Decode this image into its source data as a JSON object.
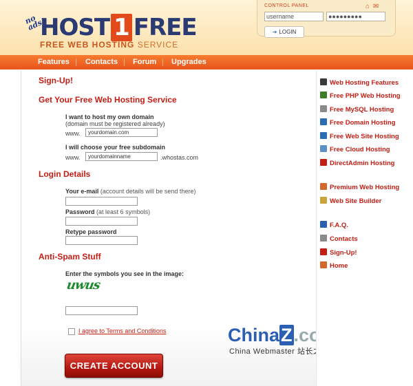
{
  "header": {
    "badge": "no ads!",
    "logo_host": "HOST",
    "logo_one": "1",
    "logo_free": "FREE",
    "tagline_main": "FREE WEB HOSTING",
    "tagline_service": "SERVICE"
  },
  "control_panel": {
    "title": "CONTROL PANEL",
    "username_value": "username",
    "password_value": "●●●●●●●●●",
    "login_label": "LOGIN",
    "home_icon": "home-icon",
    "mail_icon": "mail-icon"
  },
  "nav": {
    "items": [
      "Features",
      "Contacts",
      "Forum",
      "Upgrades"
    ]
  },
  "form": {
    "signup_title": "Sign-Up!",
    "section1_title": "Get Your Free Web Hosting Service",
    "own_domain_label": "I want to host my own domain",
    "own_domain_note": "(domain must be registered already)",
    "www_label_1": "www.",
    "own_domain_value": "yourdomain.com",
    "subdomain_label": "I will choose your free subdomain",
    "www_label_2": "www.",
    "subdomain_value": "yourdomainname",
    "subdomain_suffix": ".whostas.com",
    "section2_title": "Login Details",
    "email_label": "Your e-mail",
    "email_note": "(account details will be send there)",
    "password_label": "Password",
    "password_note": "(at least 6 symbols)",
    "retype_label": "Retype password",
    "section3_title": "Anti-Spam Stuff",
    "captcha_prompt": "Enter the symbols you see in the image:",
    "captcha_text": "uwus",
    "agree_label": "I agree to Terms and Conditions",
    "create_button": "CREATE ACCOUNT"
  },
  "watermark": {
    "brand_china": "China",
    "brand_z": "Z",
    "brand_com": ".com",
    "subtitle": "China Webmaster 站长之家"
  },
  "sidebar": {
    "items": [
      {
        "label": "Web Hosting Features",
        "icon": "monitor-icon",
        "color": "#3a3a3a"
      },
      {
        "label": "Free PHP Web Hosting",
        "icon": "php-icon",
        "color": "#3d7d2a"
      },
      {
        "label": "Free MySQL Hosting",
        "icon": "database-icon",
        "color": "#8a8a8a"
      },
      {
        "label": "Free Domain Hosting",
        "icon": "globe-icon",
        "color": "#2a6db5"
      },
      {
        "label": "Free Web Site Hosting",
        "icon": "website-icon",
        "color": "#2a6db5"
      },
      {
        "label": "Free Cloud Hosting",
        "icon": "cloud-icon",
        "color": "#5a8fc8"
      },
      {
        "label": "DirectAdmin Hosting",
        "icon": "directadmin-icon",
        "color": "#c41d13"
      },
      {
        "label": "Premium Web Hosting",
        "icon": "premium-icon",
        "color": "#d2692a"
      },
      {
        "label": "Web Site Builder",
        "icon": "builder-icon",
        "color": "#c9a43a"
      },
      {
        "label": "F.A.Q.",
        "icon": "faq-book-icon",
        "color": "#2a5fb3"
      },
      {
        "label": "Contacts",
        "icon": "contacts-mail-icon",
        "color": "#8a8a8a"
      },
      {
        "label": "Sign-Up!",
        "icon": "signup-gem-icon",
        "color": "#c41d13"
      },
      {
        "label": "Home",
        "icon": "home-icon",
        "color": "#d2692a"
      }
    ]
  }
}
